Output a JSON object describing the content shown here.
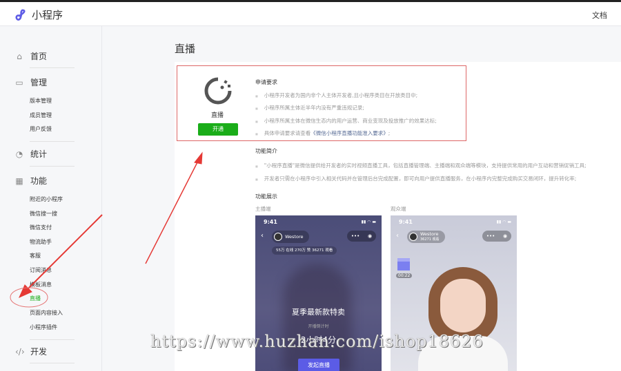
{
  "header": {
    "app_name": "小程序",
    "doc_link": "文档"
  },
  "sidebar": {
    "home": "首页",
    "manage": {
      "label": "管理",
      "items": [
        "版本管理",
        "成员管理",
        "用户反馈"
      ]
    },
    "stats": "统计",
    "features": {
      "label": "功能",
      "items": [
        "附近的小程序",
        "微信搜一搜",
        "微信支付",
        "物流助手",
        "客服",
        "订阅消息",
        "模板消息",
        "直播",
        "页面内容接入",
        "小程序插件"
      ],
      "active": "直播"
    },
    "dev": "开发"
  },
  "main": {
    "title": "直播",
    "card": {
      "name": "直播",
      "button": "开通"
    },
    "requirements": {
      "heading": "申请要求",
      "items": [
        "小程序开发者为国内非个人主体开发者,且小程序类目在开放类目中;",
        "小程序所属主体近半年内没有严重违规记录;",
        "小程序所属主体在微信生态内的用户运营、商业变现及投放推广的效果达标;"
      ],
      "last_prefix": "具体申请要求请查看",
      "last_link": "《微信小程序直播功能准入要求》",
      "last_suffix": ";"
    },
    "intro": {
      "heading": "功能简介",
      "items": [
        "\"小程序直播\"是微信提供给开发者的实时视频直播工具，包括直播管理端、主播端和观众端等模块，支持提供常用的用户互动和营销促销工具;",
        "开发者只需在小程序中引入相关代码并在管理后台完成配置，即可向用户提供直播服务，在小程序内完整完成购买交易闭环，提升转化率;"
      ]
    },
    "demo": {
      "heading": "功能展示",
      "host_label": "主播端",
      "viewer_label": "观众端"
    },
    "host_phone": {
      "time": "9:41",
      "name": "Westore",
      "stats": "55万 在线  270万 赞  36271 观看",
      "headline": "夏季最新款特卖",
      "countdown_label": "开播倒计时",
      "countdown": "2小时4分",
      "button": "发起直播"
    },
    "viewer_phone": {
      "time": "9:41",
      "name": "Westore",
      "views": "36271 观看",
      "timer": "00:22"
    }
  },
  "watermark": "https://www.huzhan.com/ishop18626",
  "colors": {
    "accent": "#1aad19",
    "link": "#576b95",
    "annotation": "#e53935"
  }
}
